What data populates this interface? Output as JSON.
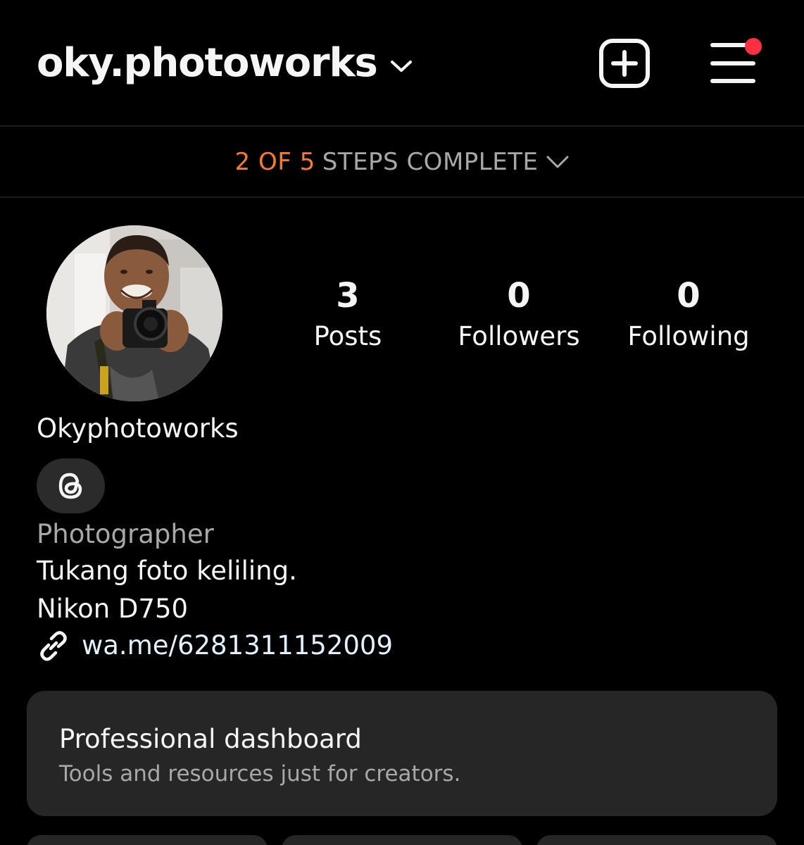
{
  "header": {
    "username": "oky.photoworks"
  },
  "steps": {
    "progress": "2 OF 5",
    "label": "STEPS COMPLETE"
  },
  "stats": {
    "posts": {
      "value": "3",
      "label": "Posts"
    },
    "followers": {
      "value": "0",
      "label": "Followers"
    },
    "following": {
      "value": "0",
      "label": "Following"
    }
  },
  "profile": {
    "display_name": "Okyphotoworks",
    "category": "Photographer",
    "bio_line_1": "Tukang foto keliling.",
    "bio_line_2": "Nikon D750",
    "link": "wa.me/6281311152009"
  },
  "dashboard": {
    "title": "Professional dashboard",
    "subtitle": "Tools and resources just for creators."
  },
  "colors": {
    "background": "#000000",
    "steps_accent": "#f77b2f",
    "notification_dot": "#ff3040",
    "card": "#262626"
  },
  "icons": [
    "chevron-down-icon",
    "create-plus-icon",
    "menu-icon",
    "threads-icon",
    "link-icon"
  ]
}
